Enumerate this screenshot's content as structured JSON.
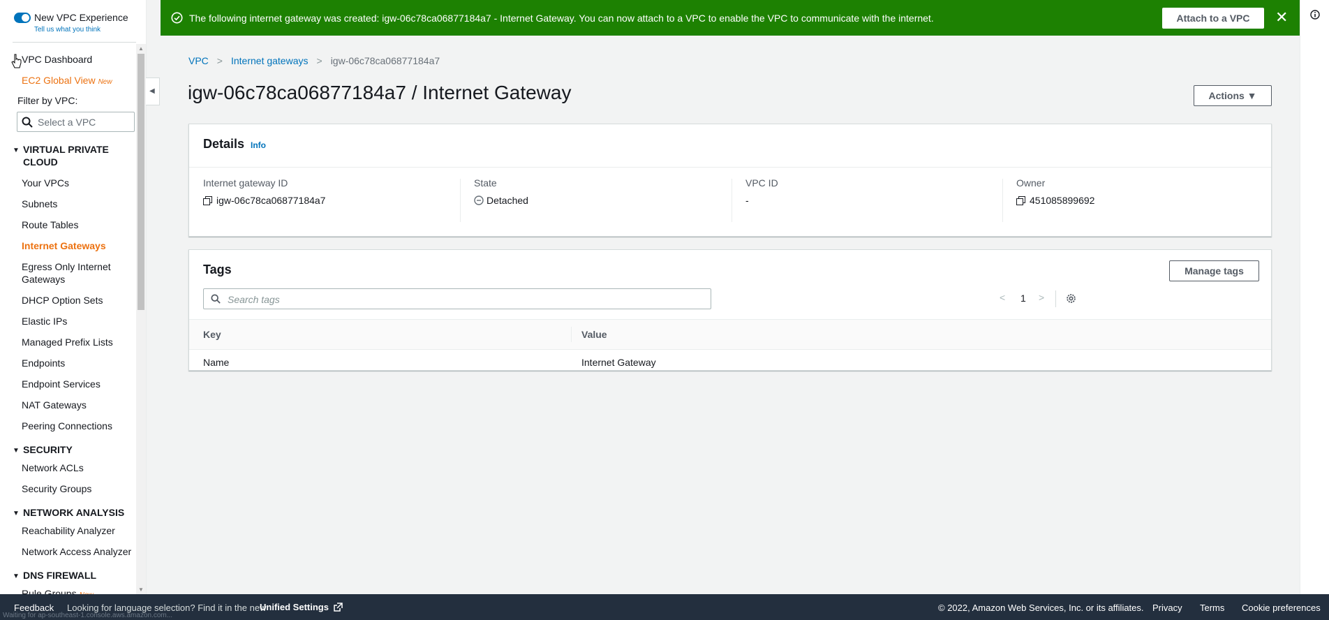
{
  "sidebar": {
    "experience_title": "New VPC Experience",
    "experience_link": "Tell us what you think",
    "dashboard": "VPC Dashboard",
    "global_view": "EC2 Global View",
    "new_badge": "New",
    "filter_label": "Filter by VPC:",
    "filter_placeholder": "Select a VPC",
    "sections": {
      "vpc": "VIRTUAL PRIVATE CLOUD",
      "security": "SECURITY",
      "network_analysis": "NETWORK ANALYSIS",
      "dns_firewall": "DNS FIREWALL"
    },
    "items": {
      "your_vpcs": "Your VPCs",
      "subnets": "Subnets",
      "route_tables": "Route Tables",
      "internet_gateways": "Internet Gateways",
      "egress_only": "Egress Only Internet Gateways",
      "dhcp": "DHCP Option Sets",
      "elastic_ips": "Elastic IPs",
      "prefix_lists": "Managed Prefix Lists",
      "endpoints": "Endpoints",
      "endpoint_services": "Endpoint Services",
      "nat_gateways": "NAT Gateways",
      "peering": "Peering Connections",
      "network_acls": "Network ACLs",
      "security_groups": "Security Groups",
      "reachability": "Reachability Analyzer",
      "network_access": "Network Access Analyzer",
      "rule_groups": "Rule Groups"
    }
  },
  "flash": {
    "message": "The following internet gateway was created: igw-06c78ca06877184a7 - Internet Gateway. You can now attach to a VPC to enable the VPC to communicate with the internet.",
    "attach_label": "Attach to a VPC",
    "close": "✕",
    "color": "#1d8102"
  },
  "breadcrumb": {
    "vpc": "VPC",
    "internet_gateways": "Internet gateways",
    "current": "igw-06c78ca06877184a7"
  },
  "page": {
    "title": "igw-06c78ca06877184a7 / Internet Gateway",
    "actions_label": "Actions ▼"
  },
  "details": {
    "title": "Details",
    "info": "Info",
    "gateway_id_label": "Internet gateway ID",
    "gateway_id": "igw-06c78ca06877184a7",
    "state_label": "State",
    "state": "Detached",
    "vpc_id_label": "VPC ID",
    "vpc_id": "-",
    "owner_label": "Owner",
    "owner": "451085899692"
  },
  "tags": {
    "title": "Tags",
    "manage_label": "Manage tags",
    "search_placeholder": "Search tags",
    "page_number": "1",
    "columns": [
      "Key",
      "Value"
    ],
    "rows": [
      [
        "Name",
        "Internet Gateway"
      ]
    ]
  },
  "footer": {
    "feedback": "Feedback",
    "language_note": "Looking for language selection? Find it in the new",
    "unified_settings": "Unified Settings",
    "status_text": "Waiting for ap-southeast-1.console.aws.amazon.com...",
    "copyright": "© 2022, Amazon Web Services, Inc. or its affiliates.",
    "privacy": "Privacy",
    "terms": "Terms",
    "cookies": "Cookie preferences"
  },
  "icons": {
    "success": "check-circle-icon",
    "search": "search-icon",
    "copy": "copy-icon",
    "detached": "minus-circle-icon",
    "settings": "gear-icon",
    "external": "external-link-icon",
    "info": "info-icon"
  },
  "colors": {
    "accent": "#0073bb",
    "active_nav": "#ec7211",
    "footer": "#232f3e"
  }
}
